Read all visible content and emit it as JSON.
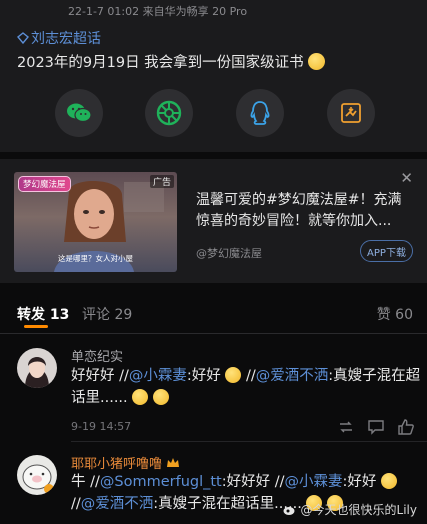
{
  "post": {
    "meta": "22-1-7 01:02  来自华为畅享 20 Pro",
    "topic": "刘志宏超话",
    "content": "2023年的9月19日 我会拿到一份国家级证书",
    "share_buttons": [
      "wechat-icon",
      "moments-icon",
      "qq-icon",
      "save-image-icon"
    ]
  },
  "ad": {
    "logo": "梦幻魔法屋",
    "tag": "广告",
    "caption": "这是哪里？女人对小屋",
    "text": "温馨可爱的#梦幻魔法屋#！充满惊喜的奇妙冒险！就等你加入...",
    "close": "✕",
    "source": "@梦幻魔法屋",
    "app_button": "APP下载"
  },
  "tabs": {
    "repost_label": "转发",
    "repost_count": "13",
    "comment_label": "评论",
    "comment_count": "29",
    "like_label": "赞",
    "like_count": "60"
  },
  "reposts": [
    {
      "name": "单恋纪实",
      "p1": "好好好 //",
      "at1": "@小霖妻",
      "p2": ":好好 ",
      "p3": " //",
      "at2": "@爱酒不洒",
      "p4": ":真嫂子混在超话里......",
      "time": "9-19 14:57"
    },
    {
      "name": "耶耶小猪呼噜噜",
      "p1": "牛 //",
      "at1": "@Sommerfugl_tt",
      "p2": ":好好好 //",
      "at2": "@小霖妻",
      "p3": ":好好 ",
      "p4": " //",
      "at3": "@爱酒不洒",
      "p5": ":真嫂子混在超话里......"
    }
  ],
  "watermark": "@今天也很快乐的Lily",
  "colors": {
    "accent": "#ff8a00",
    "link": "#5d8fd6",
    "background": "#0b0b0c",
    "card": "#1b1b1d"
  }
}
